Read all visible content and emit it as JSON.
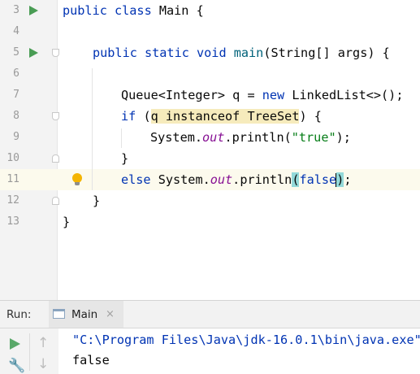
{
  "editor": {
    "lines": [
      {
        "number": "3",
        "run_gutter": true
      },
      {
        "number": "4"
      },
      {
        "number": "5",
        "run_gutter": true
      },
      {
        "number": "6"
      },
      {
        "number": "7"
      },
      {
        "number": "8"
      },
      {
        "number": "9"
      },
      {
        "number": "10"
      },
      {
        "number": "11",
        "intention_bulb": true,
        "caret_line": true
      },
      {
        "number": "12"
      },
      {
        "number": "13"
      }
    ],
    "tokens": {
      "l3_kw": "public class",
      "l3_rest": " Main {",
      "l5_kw": "public static void",
      "l5_fn": "main",
      "l5_rest": "(String[] args) {",
      "l7_type": "Queue<Integer> q = ",
      "l7_kw": "new",
      "l7_rest": " LinkedList<>();",
      "l8_kw": "if",
      "l8_open": " (",
      "l8_cond": "q instanceof TreeSet",
      "l8_rest": ") {",
      "l9_pre": "System.",
      "l9_out": "out",
      "l9_mid": ".println(",
      "l9_str": "\"true\"",
      "l9_end": ");",
      "l10_close": "}",
      "l11_kw": "else",
      "l11_pre": " System.",
      "l11_out": "out",
      "l11_mid": ".println",
      "l11_paren_open": "(",
      "l11_false": "false",
      "l11_paren_close": ")",
      "l11_end": ";",
      "l12_close": "}",
      "l13_close": "}"
    }
  },
  "run_panel": {
    "label": "Run:",
    "tab_name": "Main",
    "tab_close": "×",
    "toolbar_icons": [
      "run-icon",
      "scroll-up-icon",
      "wrench-icon",
      "scroll-down-icon"
    ],
    "console_lines": [
      "\"C:\\Program Files\\Java\\jdk-16.0.1\\bin\\java.exe\"",
      "false"
    ]
  },
  "colors": {
    "keyword": "#0033b3",
    "method": "#00627a",
    "string": "#067d17",
    "static_field": "#871094",
    "run_green": "#499c54",
    "instanceof_highlight": "#f6ebbc",
    "brace_match": "#93d9d9"
  }
}
